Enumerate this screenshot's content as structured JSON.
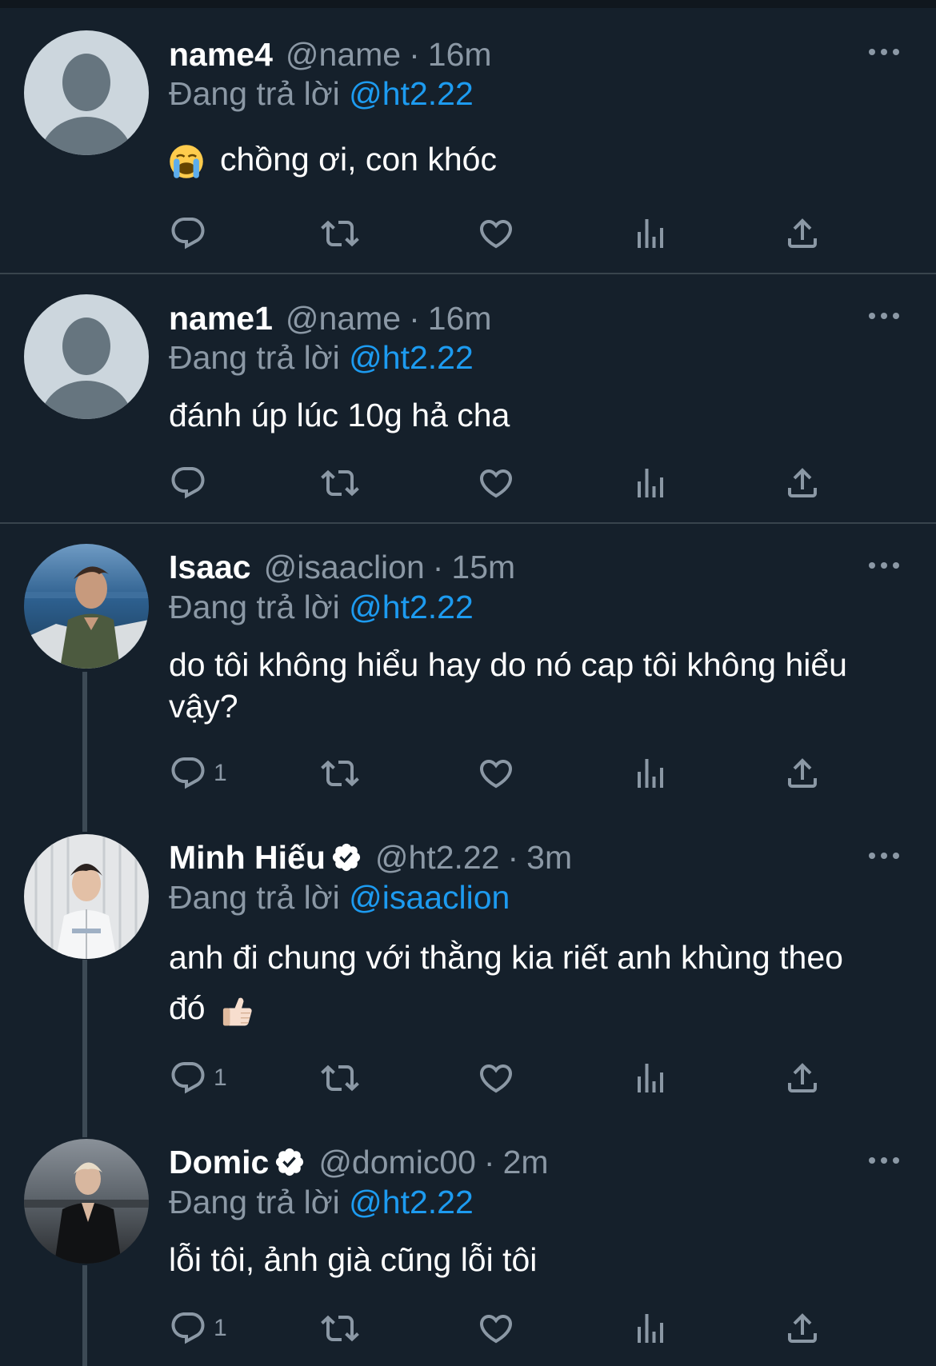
{
  "colors": {
    "background": "#15202b",
    "secondary_text": "#8b98a5",
    "mention": "#1d9bf0",
    "divider": "#38444d",
    "verified_badge": "#ffffff"
  },
  "reply_prefix": "Đang trả lời",
  "tweets": [
    {
      "name": "name4",
      "handle": "@name",
      "separator": "·",
      "time": "16m",
      "reply_to": "@ht2.22",
      "text": "chồng ơi, con khóc",
      "emoji": "loudly-crying-face",
      "verified": false,
      "reply_count": "",
      "avatar": "default-avatar"
    },
    {
      "name": "name1",
      "handle": "@name",
      "separator": "·",
      "time": "16m",
      "reply_to": "@ht2.22",
      "text": "đánh úp lúc 10g hả cha",
      "verified": false,
      "reply_count": "",
      "avatar": "default-avatar"
    },
    {
      "name": "Isaac",
      "handle": "@isaaclion",
      "separator": "·",
      "time": "15m",
      "reply_to": "@ht2.22",
      "text": "do tôi không hiểu hay do nó cap tôi không hiểu vậy?",
      "verified": false,
      "reply_count": "1",
      "avatar": "photo-sea"
    },
    {
      "name": "Minh Hiếu",
      "handle": "@ht2.22",
      "separator": "·",
      "time": "3m",
      "reply_to": "@isaaclion",
      "text": "anh đi chung với thằng kia riết anh khùng theo đó",
      "emoji": "thumbs-up",
      "verified": true,
      "reply_count": "1",
      "avatar": "photo-curtain"
    },
    {
      "name": "Domic",
      "handle": "@domic00",
      "separator": "·",
      "time": "2m",
      "reply_to": "@ht2.22",
      "text": "lỗi tôi, ảnh già cũng lỗi tôi",
      "verified": true,
      "reply_count": "1",
      "avatar": "photo-dusk"
    }
  ],
  "action_icons": [
    "reply-icon",
    "retweet-icon",
    "like-icon",
    "views-icon",
    "share-icon"
  ]
}
